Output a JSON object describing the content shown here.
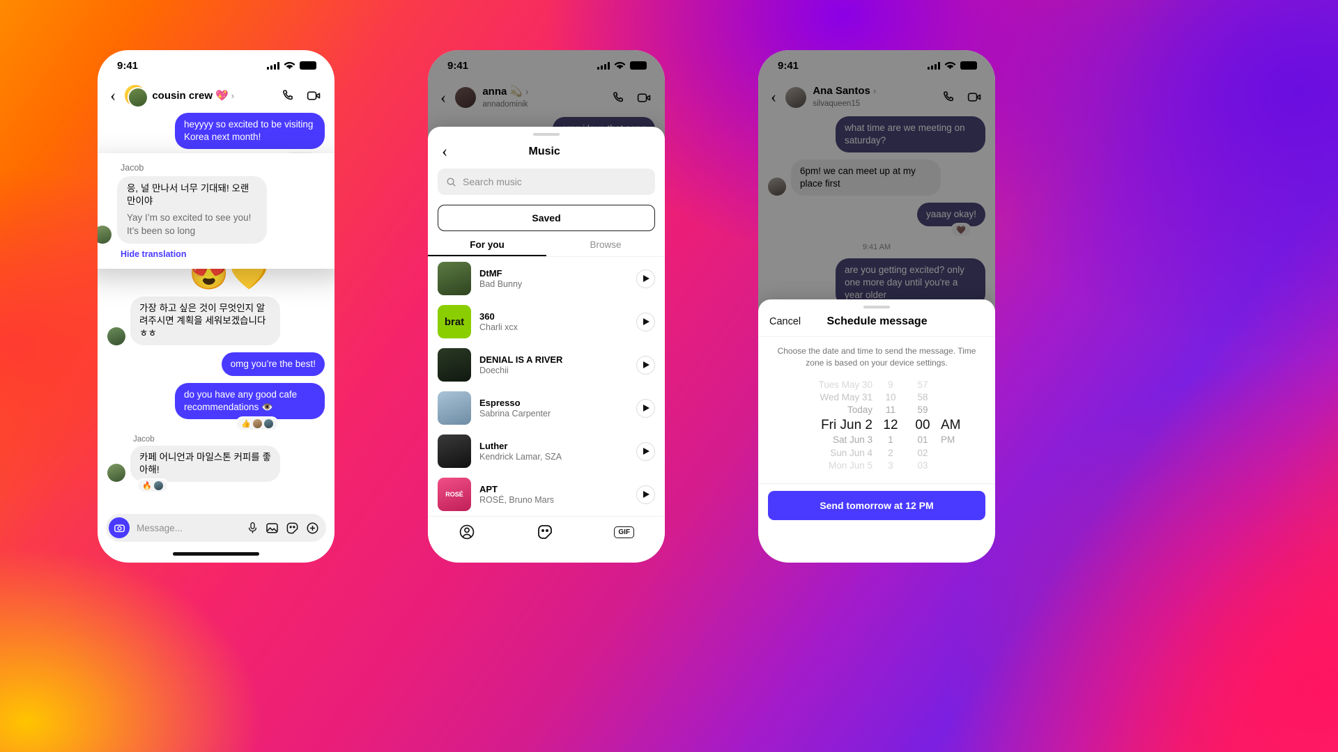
{
  "phone1": {
    "status": {
      "time": "9:41"
    },
    "header": {
      "title": "cousin crew",
      "title_emoji": "💖",
      "chevron": "›"
    },
    "messages": [
      {
        "type": "out",
        "text": "heyyyy so excited to be visiting Korea next month!",
        "reactions": "❤️"
      },
      {
        "type": "emoji",
        "text": "😍💛"
      },
      {
        "type": "in",
        "sender": "",
        "text": "가장 하고 싶은 것이 무엇인지 알려주시면 계획을 세워보겠습니다 ㅎㅎ"
      },
      {
        "type": "out",
        "text": "omg you’re the best!"
      },
      {
        "type": "out",
        "text": "do you have any good cafe recommendations 👁️",
        "reactions": "👍"
      },
      {
        "type": "in",
        "sender": "Jacob",
        "text": "카페 어니언과 마일스톤 커피를 좋아해!",
        "reactions": "🔥"
      }
    ],
    "translation_card": {
      "sender": "Jacob",
      "source_text": "응, 널 만나서 너무 기대돼! 오랜만이야",
      "translated_text": "Yay I’m so excited to see you! It’s been so long",
      "hide_label": "Hide translation"
    },
    "input": {
      "placeholder": "Message...",
      "icons": [
        "mic-icon",
        "photo-icon",
        "sticker-icon",
        "plus-icon"
      ]
    }
  },
  "phone2": {
    "status": {
      "time": "9:41"
    },
    "header": {
      "title": "anna",
      "title_emoji": "💫",
      "username": "annadominik",
      "chevron": "›"
    },
    "behind_message": "omg i love that song",
    "sheet": {
      "title": "Music",
      "search_placeholder": "Search music",
      "saved_label": "Saved",
      "tabs": [
        {
          "label": "For you",
          "active": true
        },
        {
          "label": "Browse",
          "active": false
        }
      ],
      "tracks": [
        {
          "name": "DtMF",
          "artist": "Bad Bunny",
          "art_color": "#4b5a3a",
          "art_label": ""
        },
        {
          "name": "360",
          "artist": "Charli xcx",
          "art_color": "#8ace00",
          "art_label": "brat"
        },
        {
          "name": "DENIAL IS A RIVER",
          "artist": "Doechii",
          "art_color": "#1c2b1c",
          "art_label": ""
        },
        {
          "name": "Espresso",
          "artist": "Sabrina Carpenter",
          "art_color": "#9fb7cc",
          "art_label": ""
        },
        {
          "name": "Luther",
          "artist": "Kendrick Lamar, SZA",
          "art_color": "#2a2a2a",
          "art_label": ""
        },
        {
          "name": "APT",
          "artist": "ROSÉ, Bruno Mars",
          "art_color": "#e63b6e",
          "art_label": "ROSÉ"
        }
      ],
      "bottom_icons": [
        "avatar-sticker-icon",
        "sticker-icon",
        "gif-icon"
      ],
      "gif_label": "GIF"
    }
  },
  "phone3": {
    "status": {
      "time": "9:41"
    },
    "header": {
      "title": "Ana Santos",
      "username": "silvaqueen15",
      "chevron": "›"
    },
    "messages": [
      {
        "type": "out",
        "text": "what time are we meeting on saturday?"
      },
      {
        "type": "in",
        "text": "6pm! we can meet up at my place first"
      },
      {
        "type": "out",
        "text": "yaaay okay!",
        "reactions": "❤️"
      },
      {
        "type": "timestamp",
        "text": "9:41 AM"
      },
      {
        "type": "out",
        "text": "are you getting excited? only one more day until you're a year older"
      }
    ],
    "sheet": {
      "cancel_label": "Cancel",
      "title": "Schedule message",
      "description": "Choose the date and time to send the message. Time zone is based on your device settings.",
      "picker": {
        "dates": [
          "Tues May 30",
          "Wed May 31",
          "Today",
          "Fri Jun 2",
          "Sat Jun 3",
          "Sun Jun 4",
          "Mon Jun 5"
        ],
        "selected_date": "Fri Jun 2",
        "hours": [
          "9",
          "10",
          "11",
          "12",
          "1",
          "2",
          "3"
        ],
        "selected_hour": "12",
        "minutes": [
          "57",
          "58",
          "59",
          "00",
          "01",
          "02",
          "03"
        ],
        "selected_minute": "00",
        "meridiem": [
          "AM",
          "PM"
        ],
        "selected_meridiem": "AM"
      },
      "send_label": "Send tomorrow at 12 PM"
    }
  },
  "colors": {
    "accent_blue": "#4a3aff",
    "bubble_in": "#efefef",
    "brat_green": "#8ace00"
  }
}
